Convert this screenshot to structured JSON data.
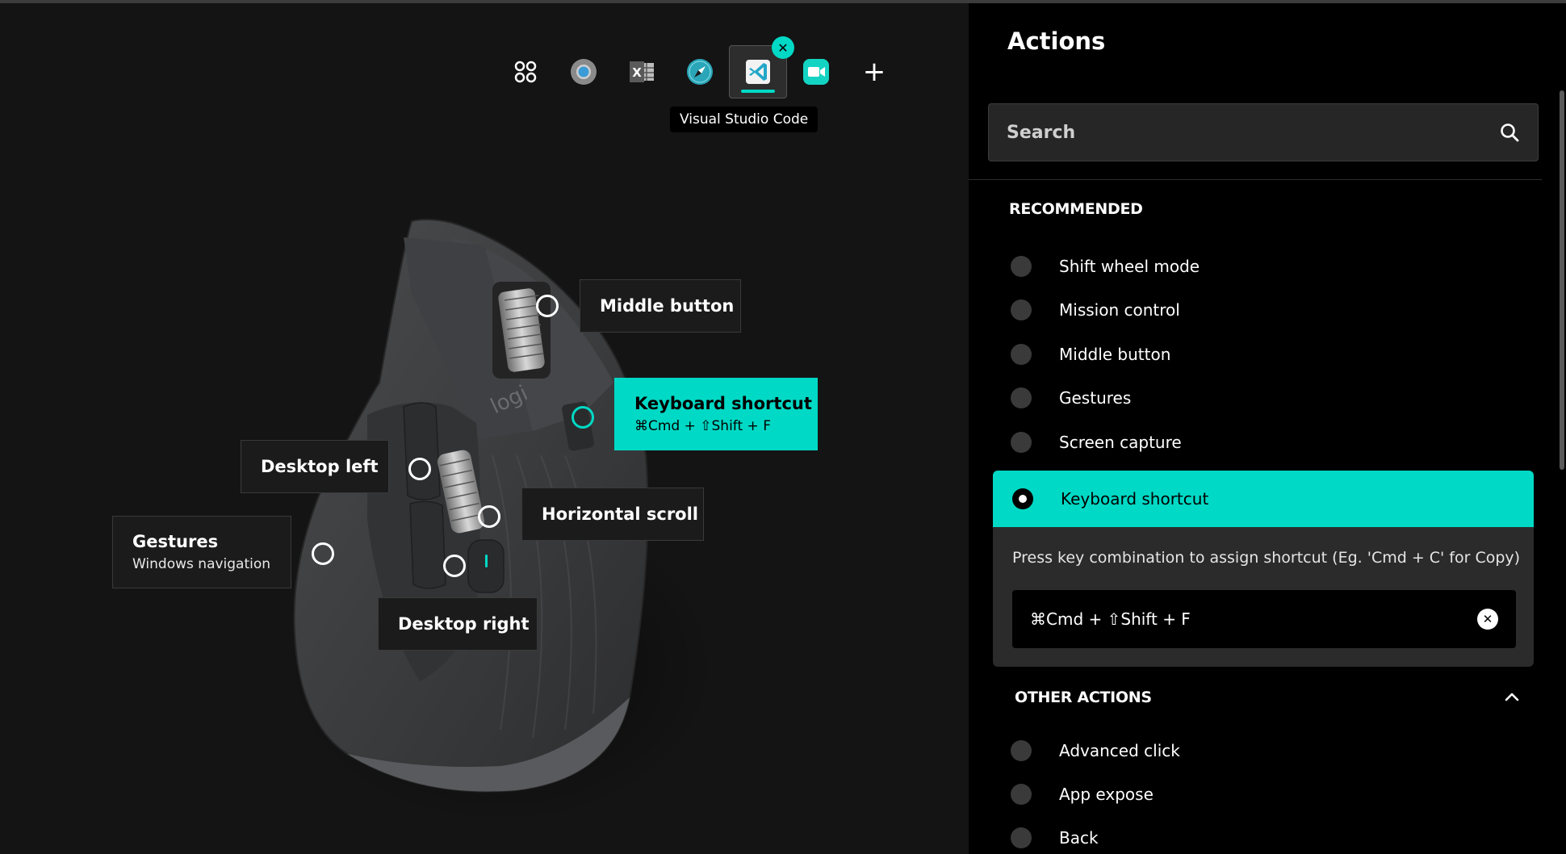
{
  "apps": [
    {
      "name": "all-applications",
      "icon": "grid-icon"
    },
    {
      "name": "chrome",
      "icon": "chrome-icon"
    },
    {
      "name": "excel",
      "icon": "excel-icon",
      "text": "X"
    },
    {
      "name": "safari",
      "icon": "safari-icon"
    },
    {
      "name": "vscode",
      "icon": "vscode-icon",
      "active": true
    },
    {
      "name": "facetime",
      "icon": "facetime-icon"
    }
  ],
  "app_bar": {
    "add_label": "+",
    "remove_label": "✕",
    "tooltip": "Visual Studio Code"
  },
  "callouts": {
    "middle_button": {
      "title": "Middle button"
    },
    "keyboard_shortcut": {
      "title": "Keyboard shortcut",
      "subtitle": "⌘Cmd + ⇧Shift + F"
    },
    "desktop_left": {
      "title": "Desktop left"
    },
    "horizontal_scroll": {
      "title": "Horizontal scroll"
    },
    "gestures": {
      "title": "Gestures",
      "subtitle": "Windows navigation"
    },
    "desktop_right": {
      "title": "Desktop right"
    }
  },
  "device": {
    "logo": "logi"
  },
  "panel": {
    "title": "Actions",
    "search_placeholder": "Search",
    "recommended_header": "RECOMMENDED",
    "recommended": [
      "Shift wheel mode",
      "Mission control",
      "Middle button",
      "Gestures",
      "Screen capture"
    ],
    "selected": {
      "label": "Keyboard shortcut",
      "hint": "Press key combination to assign shortcut (Eg. 'Cmd + C' for Copy)",
      "shortcut": "⌘Cmd + ⇧Shift + F",
      "clear_label": "✕"
    },
    "other_header": "OTHER ACTIONS",
    "other": [
      "Advanced click",
      "App expose",
      "Back"
    ]
  },
  "colors": {
    "accent": "#00d9c5",
    "panel_bg": "#000000",
    "canvas_bg": "#141414"
  }
}
